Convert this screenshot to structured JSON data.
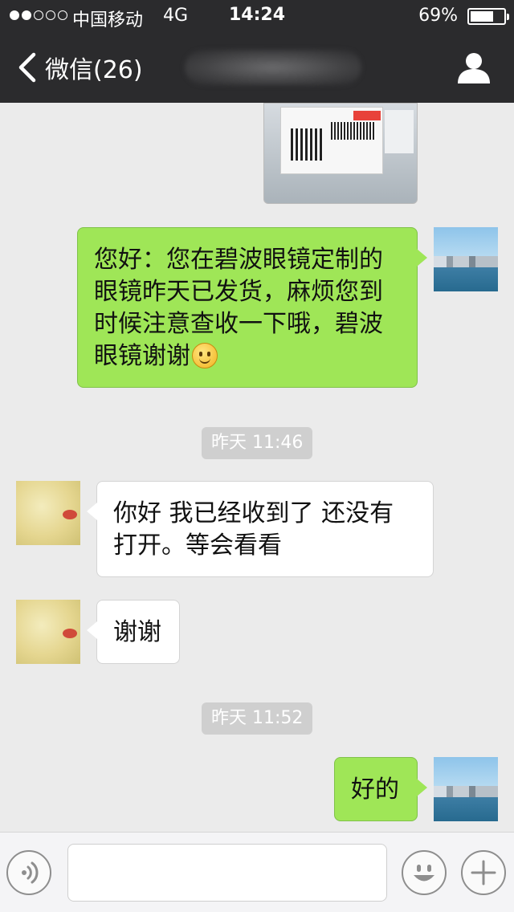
{
  "status_bar": {
    "carrier": "中国移动",
    "network": "4G",
    "time": "14:24",
    "battery_percent": "69%",
    "battery_level": 0.69,
    "signal_bars_filled": 2,
    "signal_bars_total": 5
  },
  "nav": {
    "back_label": "微信(26)",
    "title": ""
  },
  "messages": [
    {
      "type": "image",
      "side": "out",
      "description_icon": "photo-parcel"
    },
    {
      "type": "text",
      "side": "out",
      "lines": [
        "您好：您在碧波眼镜定制的",
        "眼镜昨天已发货，麻烦您到",
        "时候注意查收一下哦，碧波",
        "眼镜谢谢"
      ],
      "emoji": "smile-emoji-icon"
    },
    {
      "type": "time",
      "text": "昨天 11:46"
    },
    {
      "type": "text",
      "side": "in",
      "lines": [
        "你好 我已经收到了  还没有",
        "打开。等会看看"
      ]
    },
    {
      "type": "text",
      "side": "in",
      "lines": [
        "谢谢"
      ]
    },
    {
      "type": "time",
      "text": "昨天 11:52"
    },
    {
      "type": "text",
      "side": "out",
      "lines": [
        "好的"
      ]
    }
  ],
  "input_bar": {
    "placeholder": "",
    "buttons": [
      "voice-icon",
      "emoji-icon",
      "plus-icon"
    ]
  },
  "colors": {
    "header_bg": "#2b2b2d",
    "chat_bg": "#ebebeb",
    "bubble_out": "#9fe657",
    "bubble_in": "#ffffff",
    "timestamp_bg": "#cfcfcf"
  }
}
